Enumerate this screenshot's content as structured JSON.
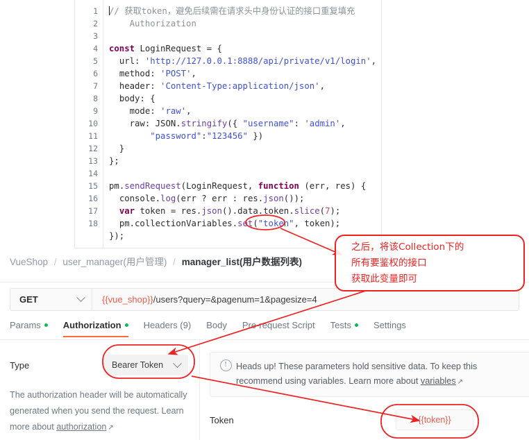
{
  "code_panel": {
    "line_numbers": [
      "1",
      "2",
      "3",
      "4",
      "5",
      "6",
      "7",
      "8",
      "9",
      "10",
      "11",
      "12",
      "13",
      "14",
      "15",
      "16",
      "17",
      "18"
    ],
    "lines": [
      "// 获取token，避免后续需在请求头中身份认证的接口重复填充",
      "    Authorization",
      "",
      "const LoginRequest = {",
      "  url: 'http://127.0.0.1:8888/api/private/v1/login',",
      "  method: 'POST',",
      "  header: 'Content-Type:application/json',",
      "  body: {",
      "    mode: 'raw',",
      "    raw: JSON.stringify({ \"username\": 'admin',",
      "        \"password\":\"123456\" })",
      "  }",
      "};",
      "",
      "pm.sendRequest(LoginRequest, function (err, res) {",
      "  console.log(err ? err : res.json());",
      "  var token = res.json().data.token.slice(7);",
      "  pm.collectionVariables.set(\"token\", token);",
      "});"
    ]
  },
  "breadcrumb": {
    "item1": "VueShop",
    "sep": "/",
    "item2": "user_manager(用户管理)",
    "item3": "manager_list(用户数据列表)"
  },
  "urlbar": {
    "method": "GET",
    "url_variable": "{{vue_shop}}",
    "url_rest": "/users?query=&pagenum=1&pagesize=4",
    "url_full": "{{vue_shop}}/users?query=&pagenum=1&pagesize=4"
  },
  "tabs": [
    {
      "label": "Params",
      "has_dot": true,
      "active": false
    },
    {
      "label": "Authorization",
      "has_dot": true,
      "active": true
    },
    {
      "label": "Headers (9)",
      "has_dot": false,
      "active": false
    },
    {
      "label": "Body",
      "has_dot": false,
      "active": false
    },
    {
      "label": "Pre-request Script",
      "has_dot": false,
      "active": false
    },
    {
      "label": "Tests",
      "has_dot": true,
      "active": false
    },
    {
      "label": "Settings",
      "has_dot": false,
      "active": false
    }
  ],
  "auth": {
    "type_label": "Type",
    "type_value": "Bearer Token",
    "help_text_1": "The authorization header will be automatically",
    "help_text_2": "generated when you send the request. Learn",
    "help_text_3": "more about ",
    "help_link": "authorization",
    "help_link_arrow": "↗",
    "heads_up_line1": "Heads up! These parameters hold sensitive data. To keep this",
    "heads_up_line2_pre": "recommend using variables. Learn more about ",
    "heads_up_link": "variables",
    "heads_up_link_arrow": "↗",
    "token_label": "Token",
    "token_value": "{{token}}"
  },
  "annotation": {
    "line1": "之后，将该Collection下的",
    "line2": "所有要鉴权的接口",
    "line3": "获取此变量即可",
    "color": "#ee2222"
  },
  "colors": {
    "accent_orange": "#ff6c37",
    "variable_red": "#ef5b48",
    "dot_green": "#0cbb52",
    "annotation_red": "#ee2222"
  }
}
